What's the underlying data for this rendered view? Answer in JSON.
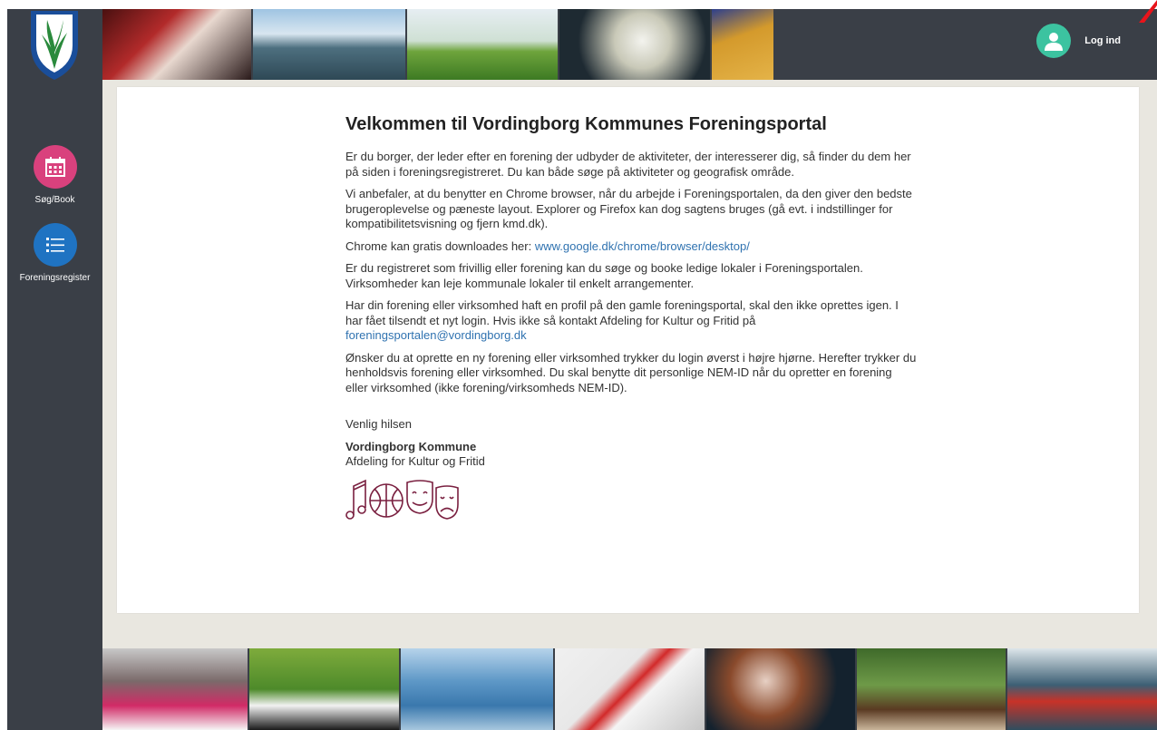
{
  "sidebar": {
    "items": [
      {
        "label": "Søg/Book",
        "icon": "calendar-icon",
        "color": "#d9417d"
      },
      {
        "label": "Foreningsregister",
        "icon": "list-icon",
        "color": "#1f73c2"
      }
    ]
  },
  "header": {
    "login_label": "Log ind",
    "photos": [
      "clown-photo",
      "kayak-lake-photo",
      "meadow-acrobat-photo",
      "badminton-shuttlecock-photo",
      "gym-floor-photo"
    ]
  },
  "content": {
    "title": "Velkommen til Vordingborg Kommunes Foreningsportal",
    "p1": "Er du borger, der leder efter en forening der udbyder de aktiviteter, der interesserer dig, så finder du dem her på siden i foreningsregistreret. Du kan både søge på aktiviteter og geografisk område.",
    "p2": "Vi anbefaler, at du benytter en Chrome browser, når du arbejde i Foreningsportalen, da den giver den bedste brugeroplevelse og pæneste layout. Explorer og Firefox kan dog sagtens bruges (gå evt. i indstillinger for kompatibilitetsvisning og fjern kmd.dk).",
    "p3_text": "Chrome kan gratis downloades her: ",
    "p3_link": "www.google.dk/chrome/browser/desktop/",
    "p4": "Er du registreret som frivillig eller forening kan du søge og booke ledige lokaler i Foreningsportalen. Virksomheder kan leje kommunale lokaler til enkelt arrangementer.",
    "p5_text": "Har din forening eller virksomhed haft en profil på den gamle foreningsportal, skal den ikke oprettes igen. I har fået tilsendt et nyt login. Hvis ikke så kontakt Afdeling for Kultur og Fritid på",
    "p5_link": "foreningsportalen@vordingborg.dk",
    "p6": "Ønsker du at oprette en ny forening eller virksomhed trykker du login øverst i højre hjørne. Herefter trykker du henholdsvis forening eller virksomhed. Du skal benytte dit personlige NEM-ID når du opretter en forening eller virksomhed (ikke forening/virksomheds NEM-ID).",
    "greeting": "Venlig hilsen",
    "signer": "Vordingborg Kommune",
    "department": "Afdeling for Kultur og Fritid",
    "link_color": "#2f72b0"
  },
  "footer": {
    "photos": [
      "ballet-dancer-photo",
      "football-photo",
      "beach-jetty-photo",
      "karate-photo",
      "clown-makeup-photo",
      "horse-jumping-photo",
      "kayaking-photo"
    ]
  },
  "colors": {
    "sidebar_bg": "#3a3f47",
    "main_bg": "#e9e7e0",
    "login_avatar": "#3cc3a0"
  }
}
